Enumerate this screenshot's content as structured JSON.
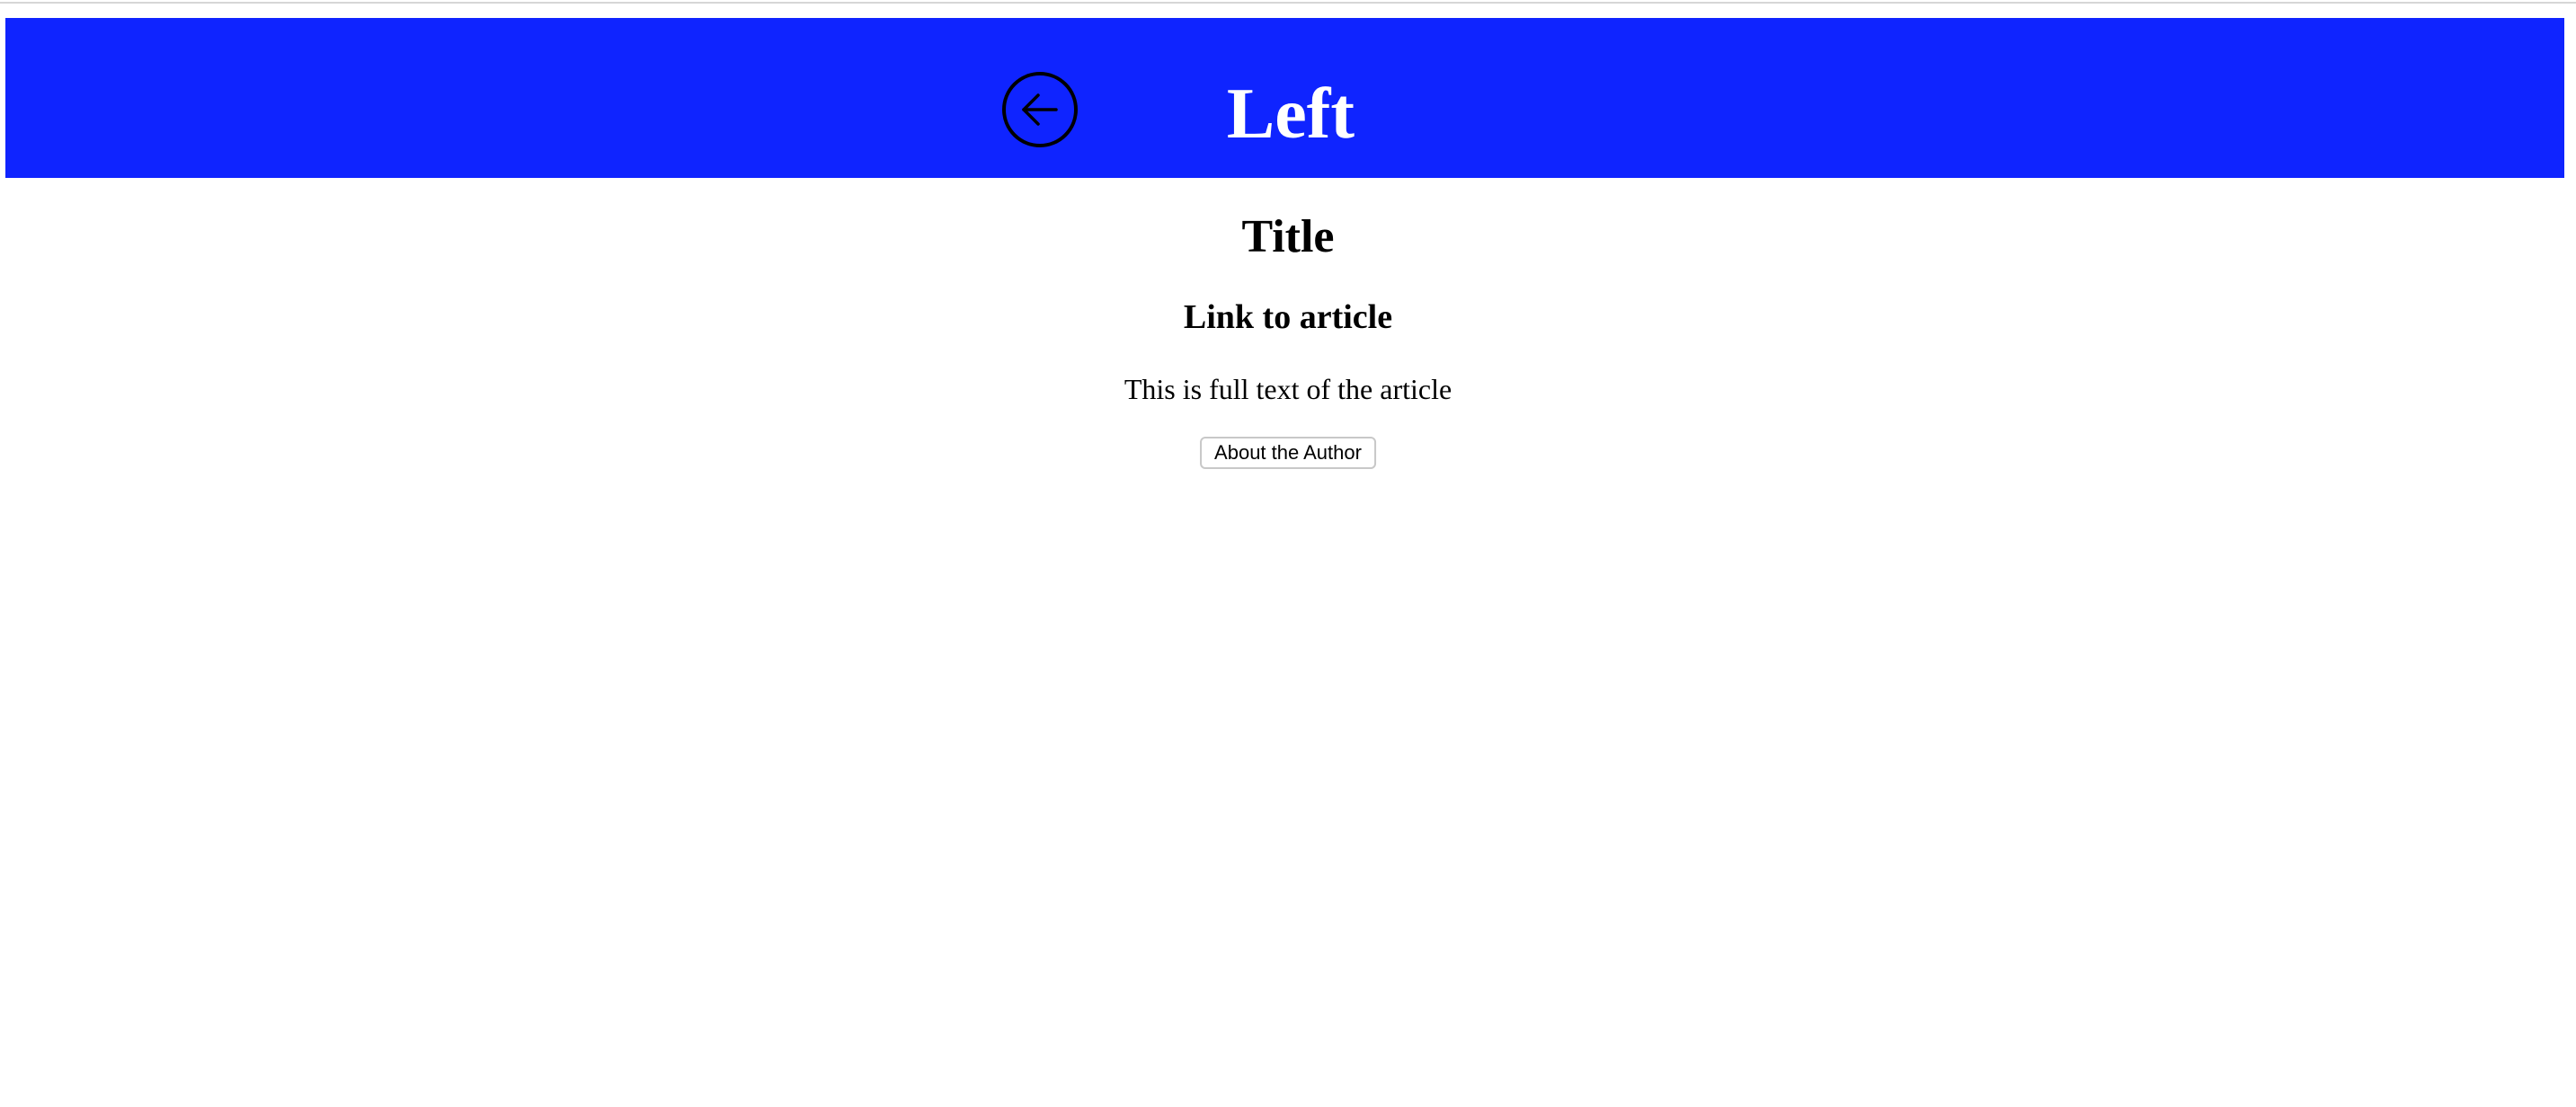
{
  "header": {
    "title": "Left",
    "back_icon": "arrow-left-circle-icon",
    "background_color": "#0f24ff",
    "title_color": "#ffffff"
  },
  "article": {
    "title": "Title",
    "link_label": "Link to article",
    "full_text": "This is full text of the article",
    "author_button_label": "About the Author"
  }
}
